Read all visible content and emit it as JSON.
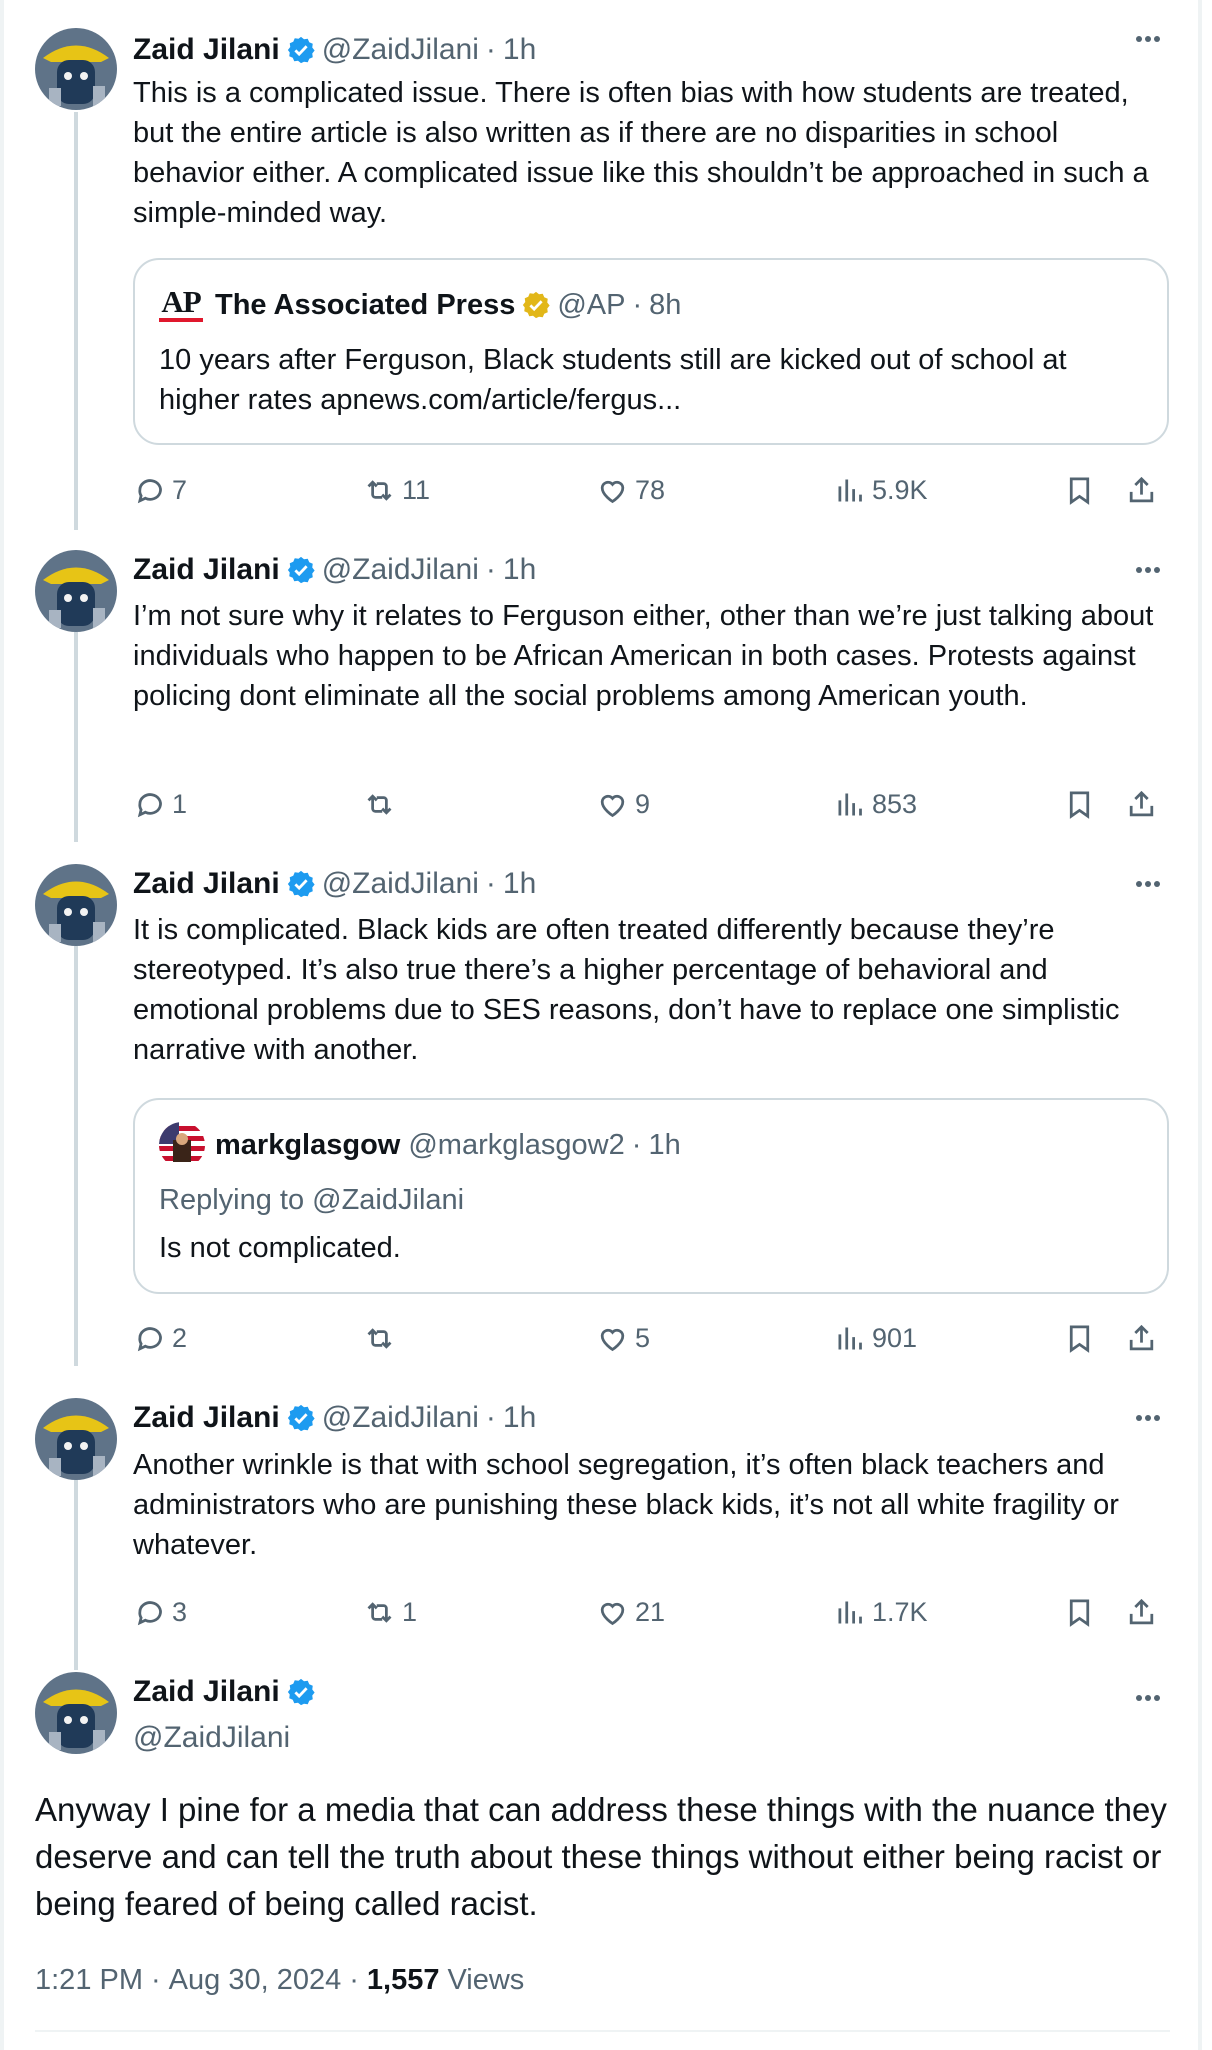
{
  "author": {
    "name": "Zaid Jilani",
    "handle": "@ZaidJilani"
  },
  "icons": {
    "verified_blue": "#1d9bf0",
    "verified_gold": "#e2b719",
    "reply": "reply-icon",
    "retweet": "retweet-icon",
    "like": "heart-icon",
    "views": "views-icon",
    "bookmark": "bookmark-icon",
    "share": "share-icon",
    "more": "more-icon"
  },
  "tweets": [
    {
      "time": "1h",
      "text": "This is a complicated issue. There is often bias with how students are treated, but the entire article is also written  as if there are no disparities in school behavior either. A complicated issue like this shouldn’t be approached in such a simple-minded way.",
      "quote": {
        "logo_text": "AP",
        "name": "The Associated Press",
        "handle": "@AP",
        "time": "8h",
        "text": "10 years after Ferguson, Black students still are kicked out of school at higher rates apnews.com/article/fergus..."
      },
      "replies": "7",
      "retweets": "11",
      "likes": "78",
      "views": "5.9K"
    },
    {
      "time": "1h",
      "text": "I’m not sure why it relates to Ferguson either, other than we’re just talking about individuals who happen to be African American in both cases. Protests against policing dont eliminate all the social problems among American youth.",
      "replies": "1",
      "retweets": "",
      "likes": "9",
      "views": "853"
    },
    {
      "time": "1h",
      "text": "It is complicated. Black kids are often treated differently because they’re stereotyped. It’s also true there’s a higher percentage of behavioral and emotional problems due to SES reasons, don’t have to replace one simplistic narrative with another.",
      "quote": {
        "name": "markglasgow",
        "handle": "@markglasgow2",
        "time": "1h",
        "replying": "Replying to @ZaidJilani",
        "text": "Is not complicated."
      },
      "replies": "2",
      "retweets": "",
      "likes": "5",
      "views": "901"
    },
    {
      "time": "1h",
      "text": "Another wrinkle is that with school segregation, it’s often black teachers and administrators who are punishing these black kids, it’s not all white fragility or whatever.",
      "replies": "3",
      "retweets": "1",
      "likes": "21",
      "views": "1.7K"
    }
  ],
  "main_tweet": {
    "text": "Anyway I pine for a media that can address these things with the nuance they deserve and can tell the truth about these things without either being racist or being feared of being called racist.",
    "time": "1:21 PM",
    "date": "Aug 30, 2024",
    "views_count": "1,557",
    "views_label": "Views"
  },
  "separator": "·"
}
